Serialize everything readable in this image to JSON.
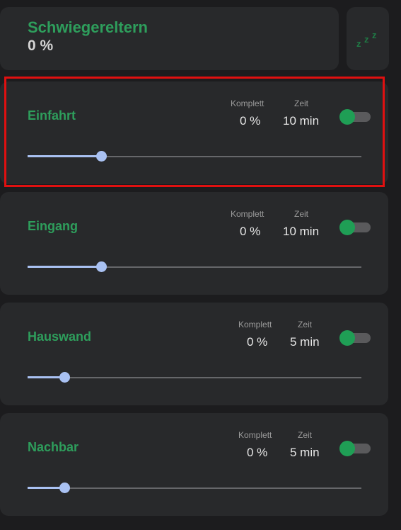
{
  "header": {
    "title": "Schwiegereltern",
    "value": "0 %",
    "sleep_icon": "sleep-zzz-icon"
  },
  "labels": {
    "complete": "Komplett",
    "time": "Zeit"
  },
  "zones": [
    {
      "name": "Einfahrt",
      "complete": "0 %",
      "time": "10 min",
      "enabled": true,
      "slider_fraction": 0.22,
      "highlighted": true
    },
    {
      "name": "Eingang",
      "complete": "0 %",
      "time": "10 min",
      "enabled": true,
      "slider_fraction": 0.22,
      "highlighted": false
    },
    {
      "name": "Hauswand",
      "complete": "0 %",
      "time": "5 min",
      "enabled": true,
      "slider_fraction": 0.11,
      "highlighted": false
    },
    {
      "name": "Nachbar",
      "complete": "0 %",
      "time": "5 min",
      "enabled": true,
      "slider_fraction": 0.11,
      "highlighted": false
    }
  ],
  "colors": {
    "accent_green": "#2e9e5c",
    "toggle_on": "#1f9e55",
    "slider": "#a9c1f2",
    "highlight_border": "#e01010"
  }
}
